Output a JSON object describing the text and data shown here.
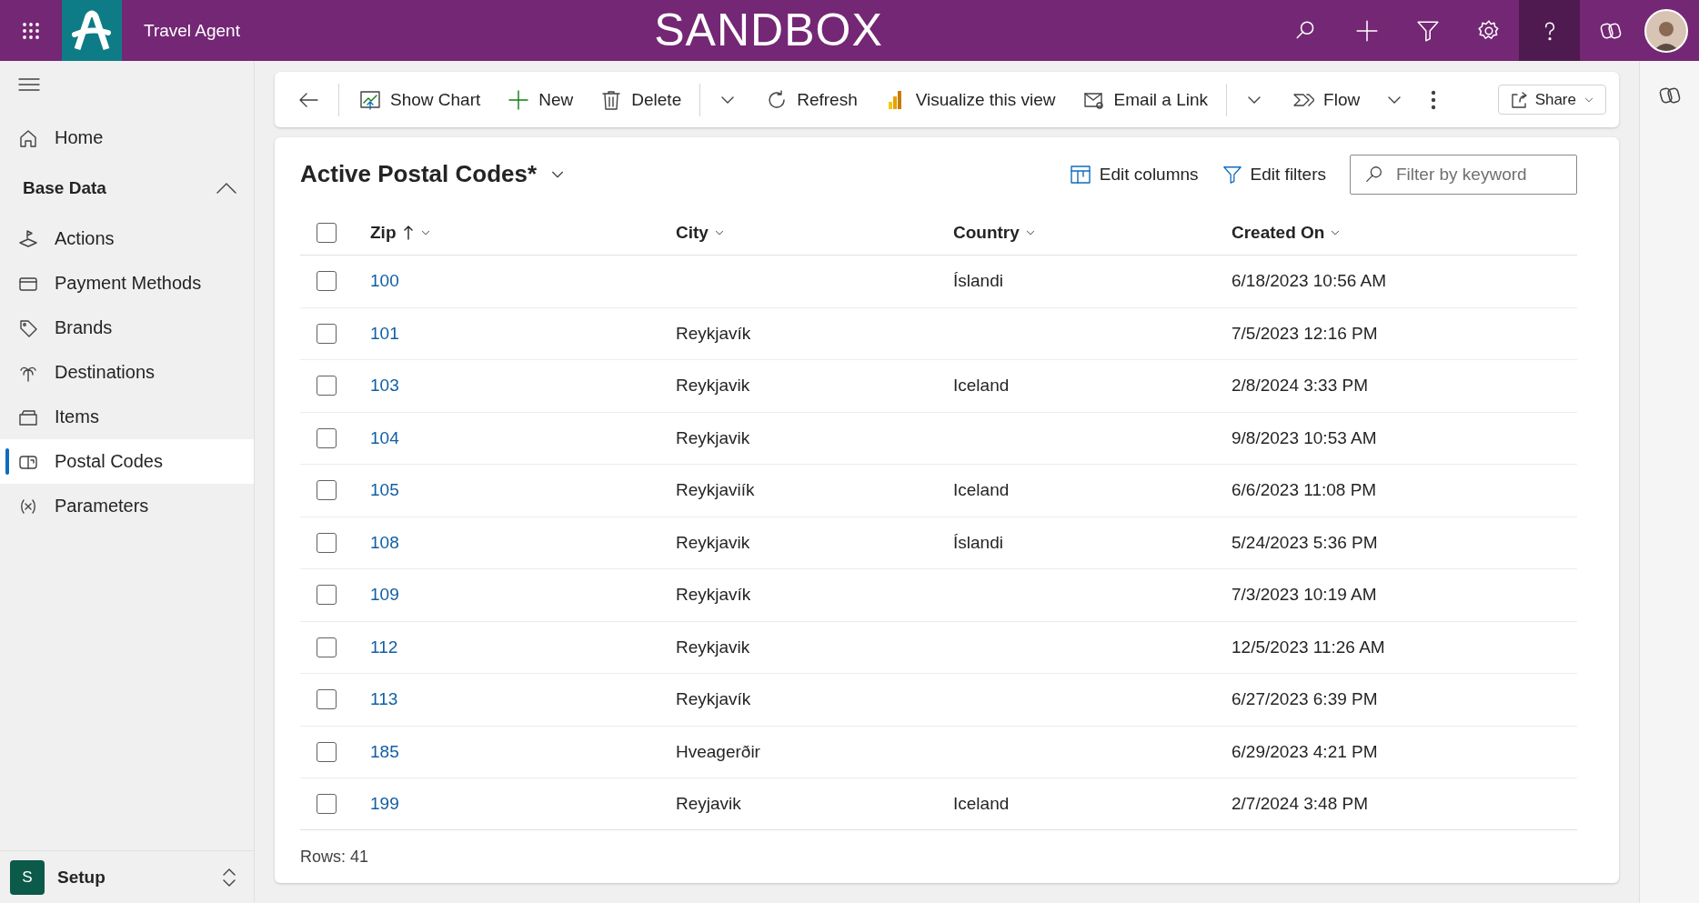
{
  "app": {
    "title": "Travel Agent",
    "environment": "SANDBOX"
  },
  "sidebar": {
    "home": {
      "label": "Home"
    },
    "group": {
      "label": "Base Data",
      "expanded": true
    },
    "items": [
      {
        "label": "Actions",
        "selected": false
      },
      {
        "label": "Payment Methods",
        "selected": false
      },
      {
        "label": "Brands",
        "selected": false
      },
      {
        "label": "Destinations",
        "selected": false
      },
      {
        "label": "Items",
        "selected": false
      },
      {
        "label": "Postal Codes",
        "selected": true
      },
      {
        "label": "Parameters",
        "selected": false
      }
    ],
    "area": {
      "badge": "S",
      "label": "Setup"
    }
  },
  "command_bar": {
    "items": [
      {
        "kind": "back"
      },
      {
        "kind": "button",
        "label": "Show Chart"
      },
      {
        "kind": "button",
        "label": "New"
      },
      {
        "kind": "button",
        "label": "Delete"
      },
      {
        "kind": "caret"
      },
      {
        "kind": "button",
        "label": "Refresh"
      },
      {
        "kind": "button",
        "label": "Visualize this view"
      },
      {
        "kind": "button",
        "label": "Email a Link"
      },
      {
        "kind": "caret"
      },
      {
        "kind": "button",
        "label": "Flow"
      },
      {
        "kind": "dropdown"
      },
      {
        "kind": "more"
      }
    ],
    "share": "Share"
  },
  "view": {
    "title": "Active Postal Codes*",
    "edit_columns": "Edit columns",
    "edit_filters": "Edit filters",
    "filter": {
      "placeholder": "Filter by keyword"
    }
  },
  "table": {
    "all_selected": false,
    "columns": [
      {
        "label": "Zip",
        "sorted": true
      },
      {
        "label": "City",
        "sorted": false
      },
      {
        "label": "Country",
        "sorted": false
      },
      {
        "label": "Created On",
        "sorted": false
      }
    ],
    "rows": [
      {
        "zip": "100",
        "city": "",
        "country": "Íslandi",
        "created_on": "6/18/2023 10:56 AM",
        "selected": false
      },
      {
        "zip": "101",
        "city": "Reykjavík",
        "country": "",
        "created_on": "7/5/2023 12:16 PM",
        "selected": false
      },
      {
        "zip": "103",
        "city": "Reykjavik",
        "country": "Iceland",
        "created_on": "2/8/2024 3:33 PM",
        "selected": false
      },
      {
        "zip": "104",
        "city": "Reykjavik",
        "country": "",
        "created_on": "9/8/2023 10:53 AM",
        "selected": false
      },
      {
        "zip": "105",
        "city": "Reykjaviík",
        "country": "Iceland",
        "created_on": "6/6/2023 11:08 PM",
        "selected": false
      },
      {
        "zip": "108",
        "city": "Reykjavik",
        "country": "Íslandi",
        "created_on": "5/24/2023 5:36 PM",
        "selected": false
      },
      {
        "zip": "109",
        "city": "Reykjavík",
        "country": "",
        "created_on": "7/3/2023 10:19 AM",
        "selected": false
      },
      {
        "zip": "112",
        "city": "Reykjavik",
        "country": "",
        "created_on": "12/5/2023 11:26 AM",
        "selected": false
      },
      {
        "zip": "113",
        "city": "Reykjavík",
        "country": "",
        "created_on": "6/27/2023 6:39 PM",
        "selected": false
      },
      {
        "zip": "185",
        "city": "Hveagerðir",
        "country": "",
        "created_on": "6/29/2023 4:21 PM",
        "selected": false
      },
      {
        "zip": "199",
        "city": "Reyjavik",
        "country": "Iceland",
        "created_on": "2/7/2024 3:48 PM",
        "selected": false
      }
    ],
    "footer": "Rows: 41"
  }
}
